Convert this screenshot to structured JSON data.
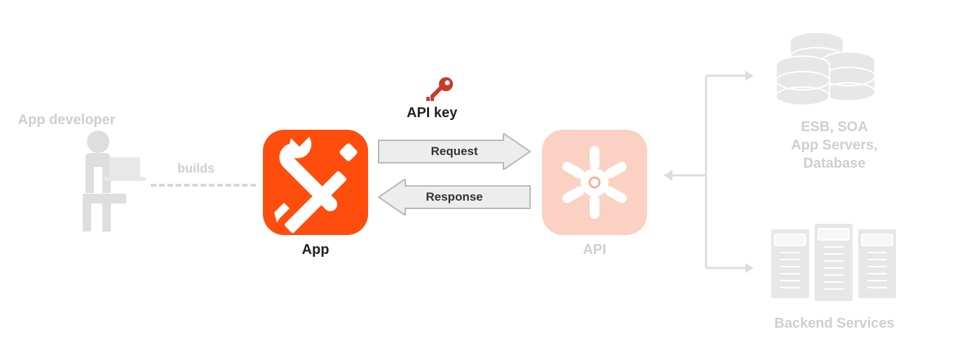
{
  "developer": {
    "label": "App developer"
  },
  "builds": {
    "label": "builds"
  },
  "app": {
    "label": "App"
  },
  "apikey": {
    "label": "API key"
  },
  "request": {
    "label": "Request"
  },
  "response": {
    "label": "Response"
  },
  "api": {
    "label": "API"
  },
  "backend": {
    "middle": "ESB, SOA\nApp Servers,\nDatabase",
    "label": "Backend Services"
  },
  "colors": {
    "accent": "#ff4d0d",
    "accent_light": "#fad1c2",
    "key_red": "#c63c2b",
    "ghost": "#dedede",
    "arrow_fill": "#ededed",
    "arrow_stroke": "#b8b8b8"
  }
}
